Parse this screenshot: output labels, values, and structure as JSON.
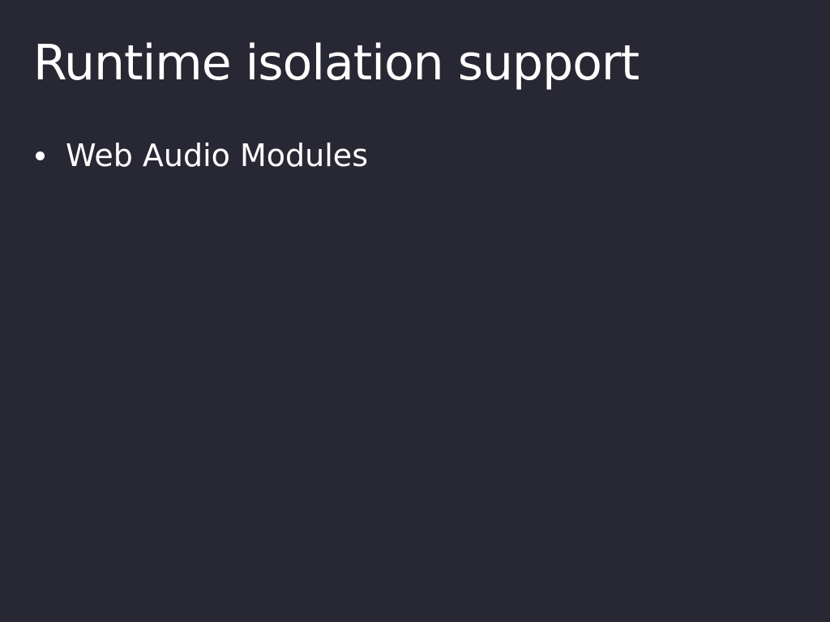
{
  "slide": {
    "title": "Runtime isolation support",
    "bullets": [
      {
        "text": "Web Audio Modules"
      }
    ]
  },
  "colors": {
    "background": "#282834",
    "text": "#ffffff"
  }
}
